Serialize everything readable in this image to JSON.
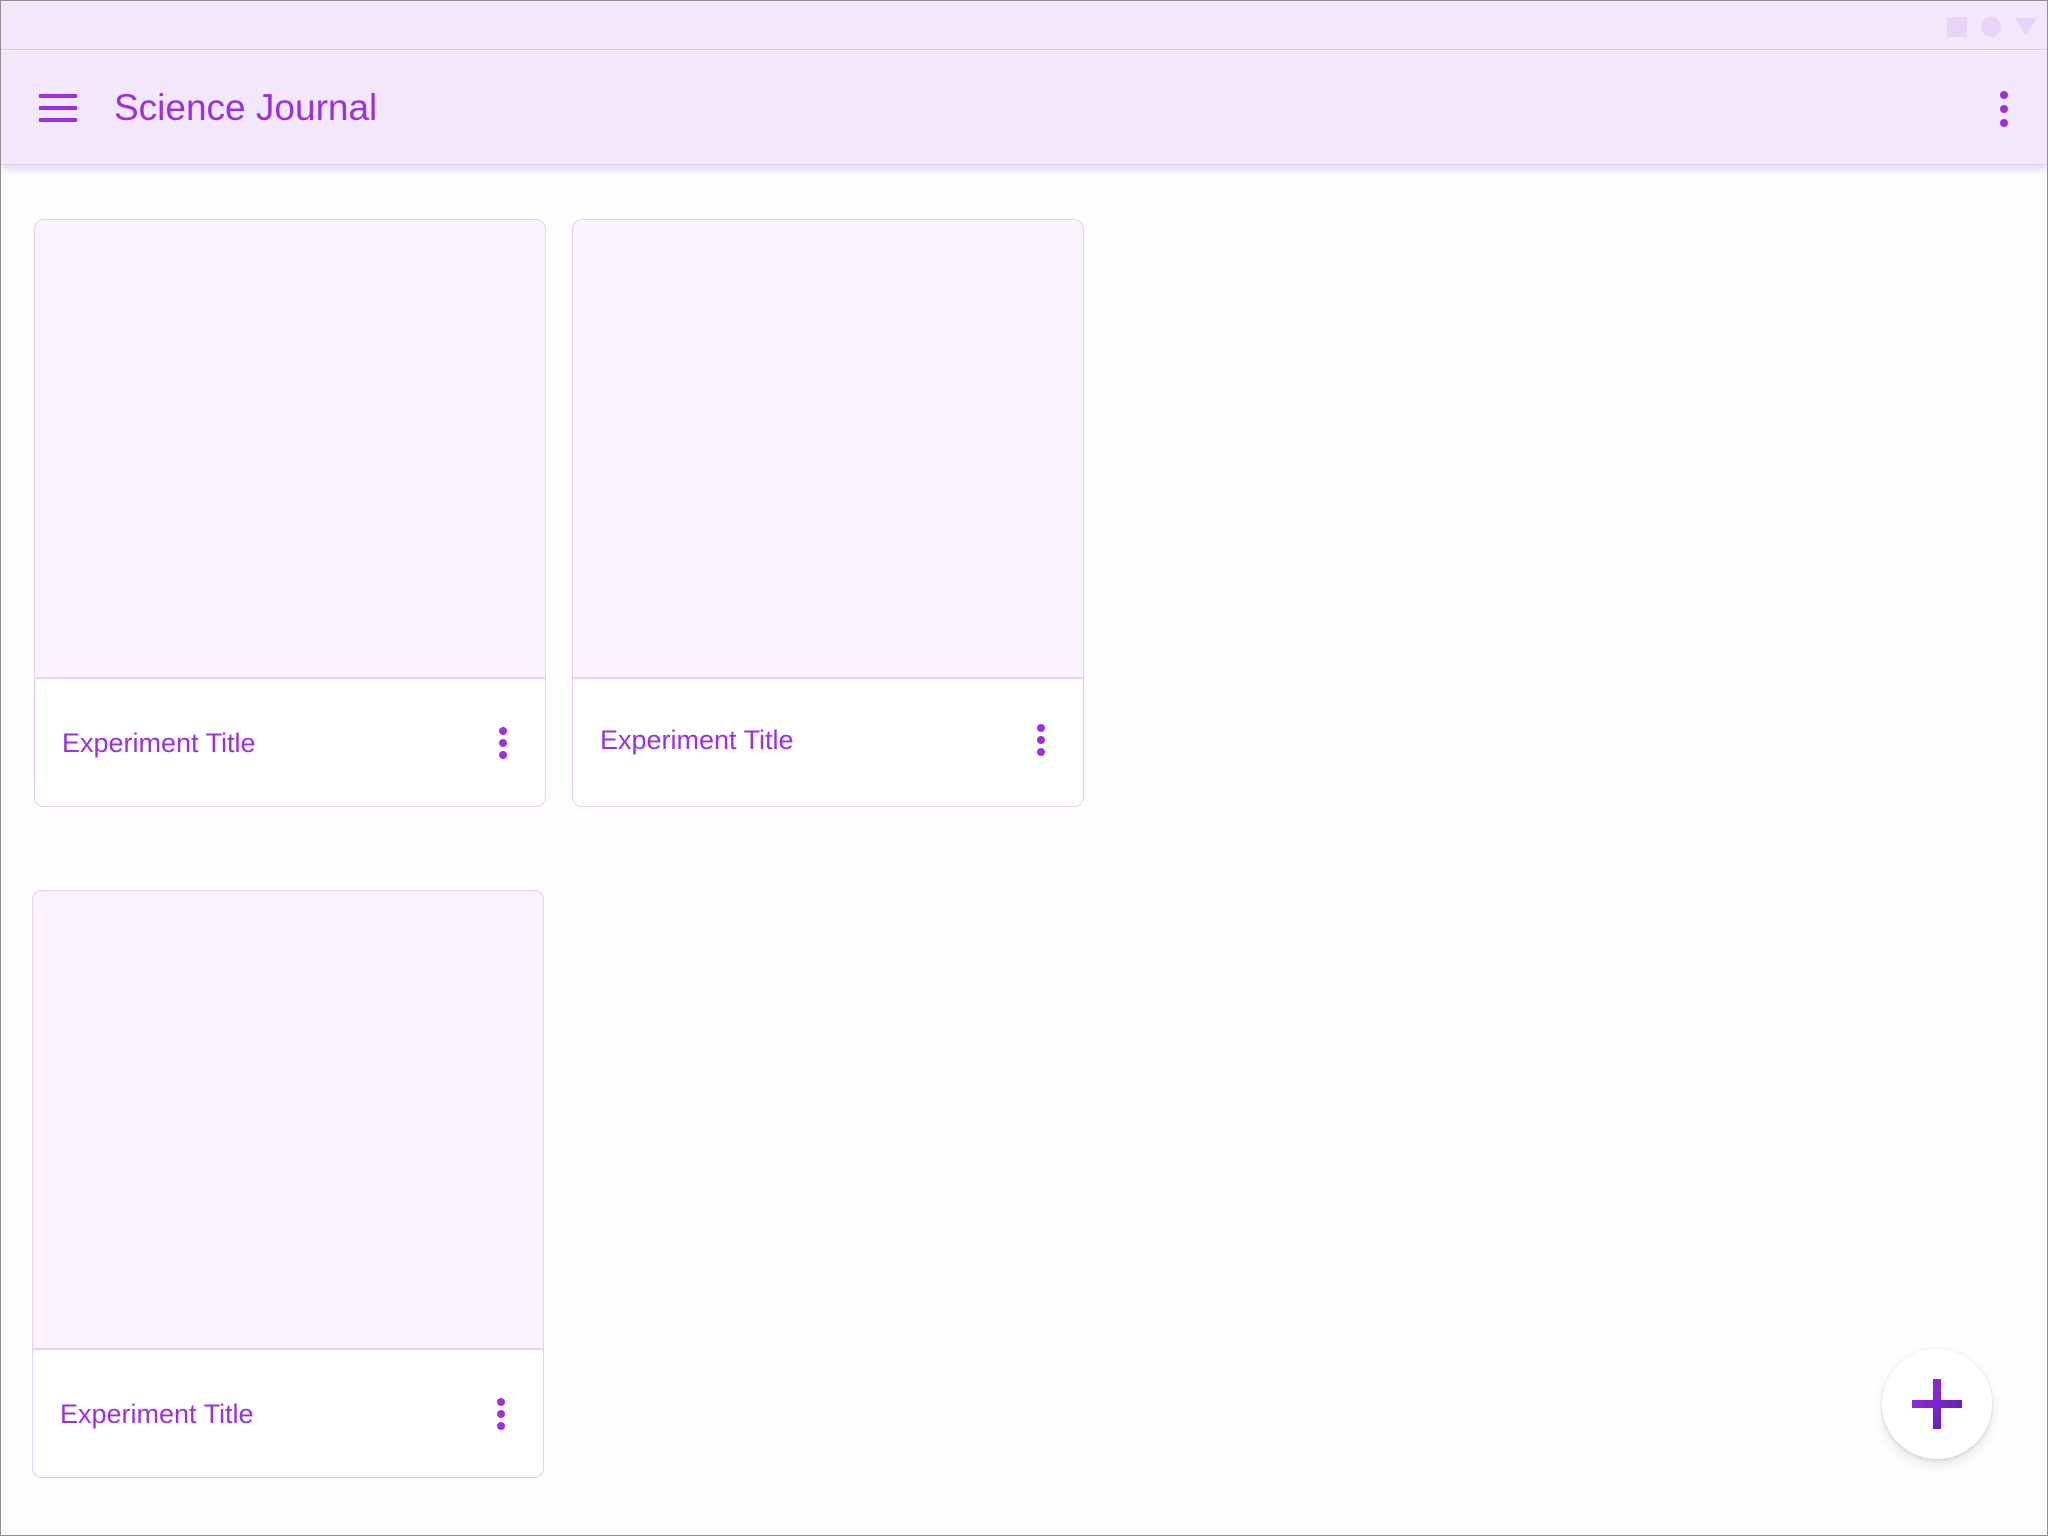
{
  "status_bar": {
    "icons": [
      "square-icon",
      "circle-icon",
      "triangle-icon"
    ],
    "color": "#e8d4f8"
  },
  "app_bar": {
    "title": "Science Journal",
    "menu_icon": "hamburger-menu-icon",
    "overflow_icon": "more-vert-icon",
    "background": "#f3e8fb",
    "accent": "#9c2fe0"
  },
  "experiments": [
    {
      "title": "Experiment Title",
      "menu_icon": "more-vert-icon"
    },
    {
      "title": "Experiment Title",
      "menu_icon": "more-vert-icon"
    },
    {
      "title": "Experiment Title",
      "menu_icon": "more-vert-icon"
    }
  ],
  "fab": {
    "icon": "add-icon",
    "icon_color": "#7a24cc"
  }
}
